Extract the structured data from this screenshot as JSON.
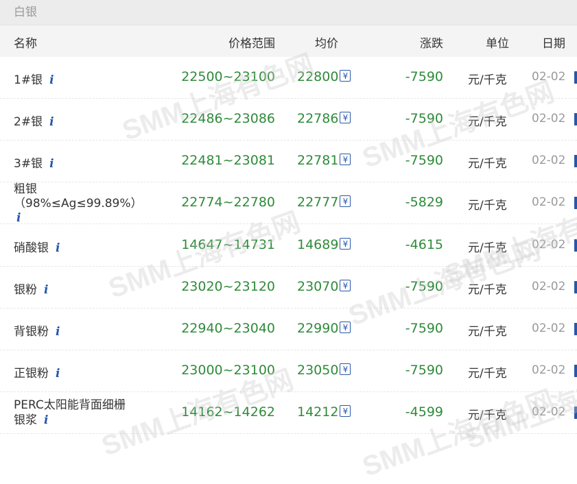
{
  "section_title": "白银",
  "headers": {
    "name": "名称",
    "range": "价格范围",
    "avg": "均价",
    "change": "涨跌",
    "unit": "单位",
    "date": "日期"
  },
  "watermark": "SMM上海有色网",
  "rows": [
    {
      "name": "1#银",
      "range": "22500~23100",
      "avg": "22800",
      "change": "-7590",
      "unit": "元/千克",
      "date": "02-02"
    },
    {
      "name": "2#银",
      "range": "22486~23086",
      "avg": "22786",
      "change": "-7590",
      "unit": "元/千克",
      "date": "02-02"
    },
    {
      "name": "3#银",
      "range": "22481~23081",
      "avg": "22781",
      "change": "-7590",
      "unit": "元/千克",
      "date": "02-02"
    },
    {
      "name": "粗银",
      "name_sub": "（98%≤Ag≤99.89%）",
      "range": "22774~22780",
      "avg": "22777",
      "change": "-5829",
      "unit": "元/千克",
      "date": "02-02"
    },
    {
      "name": "硝酸银",
      "range": "14647~14731",
      "avg": "14689",
      "change": "-4615",
      "unit": "元/千克",
      "date": "02-02"
    },
    {
      "name": "银粉",
      "range": "23020~23120",
      "avg": "23070",
      "change": "-7590",
      "unit": "元/千克",
      "date": "02-02"
    },
    {
      "name": "背银粉",
      "range": "22940~23040",
      "avg": "22990",
      "change": "-7590",
      "unit": "元/千克",
      "date": "02-02"
    },
    {
      "name": "正银粉",
      "range": "23000~23100",
      "avg": "23050",
      "change": "-7590",
      "unit": "元/千克",
      "date": "02-02"
    },
    {
      "name": "PERC太阳能背面细栅",
      "name_sub": "银浆",
      "range": "14162~14262",
      "avg": "14212",
      "change": "-4599",
      "unit": "元/千克",
      "date": "02-02"
    }
  ],
  "icons": {
    "info": "i",
    "yen": "¥"
  },
  "colors": {
    "price_green": "#2f8a3a",
    "icon_blue": "#2757a8"
  }
}
